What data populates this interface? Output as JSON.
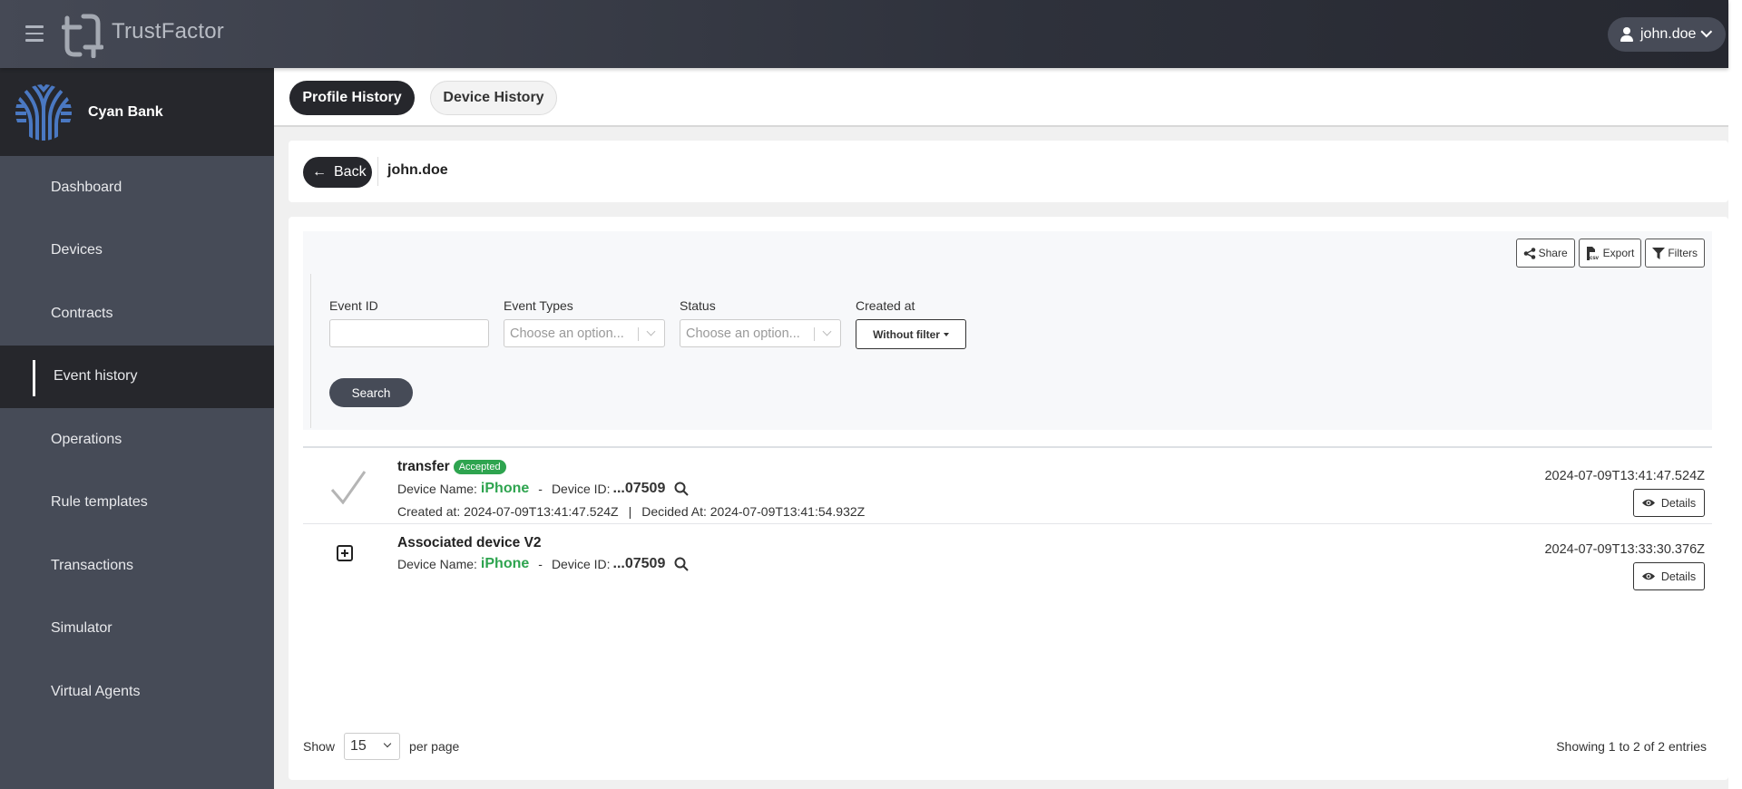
{
  "app": {
    "brand": "TrustFactor",
    "user": "john.doe"
  },
  "organization": {
    "name": "Cyan Bank",
    "logo_color": "#4a78c2"
  },
  "sidebar": {
    "items": [
      {
        "label": "Dashboard"
      },
      {
        "label": "Devices"
      },
      {
        "label": "Contracts"
      },
      {
        "label": "Event history",
        "active": true
      },
      {
        "label": "Operations"
      },
      {
        "label": "Rule templates"
      },
      {
        "label": "Transactions"
      },
      {
        "label": "Simulator"
      },
      {
        "label": "Virtual Agents"
      }
    ]
  },
  "tabs": [
    {
      "label": "Profile History",
      "active": true
    },
    {
      "label": "Device History",
      "active": false
    }
  ],
  "breadcrumb": {
    "back_label": "Back",
    "current": "john.doe"
  },
  "toolbar": {
    "share": "Share",
    "export": "Export",
    "filters": "Filters"
  },
  "filters": {
    "event_id": {
      "label": "Event ID",
      "value": ""
    },
    "event_types": {
      "label": "Event Types",
      "placeholder": "Choose an option..."
    },
    "status": {
      "label": "Status",
      "placeholder": "Choose an option..."
    },
    "created_at": {
      "label": "Created at",
      "value": "Without filter"
    },
    "search_label": "Search"
  },
  "events": [
    {
      "icon": "check-icon",
      "title": "transfer",
      "status": "Accepted",
      "status_color": "#2ea44f",
      "device_name_label": "Device Name:",
      "device_name": "iPhone",
      "device_id_label": "Device ID:",
      "device_id": "...07509",
      "created_label": "Created at: 2024-07-09T13:41:47.524Z",
      "decided_label": "Decided At: 2024-07-09T13:41:54.932Z",
      "timestamp": "2024-07-09T13:41:47.524Z",
      "details_label": "Details"
    },
    {
      "icon": "plus-square-icon",
      "title": "Associated device V2",
      "device_name_label": "Device Name:",
      "device_name": "iPhone",
      "device_id_label": "Device ID:",
      "device_id": "...07509",
      "timestamp": "2024-07-09T13:33:30.376Z",
      "details_label": "Details"
    }
  ],
  "pagination": {
    "show_label": "Show",
    "per_page_value": "15",
    "per_page_label": "per page",
    "summary": "Showing 1 to 2 of 2 entries"
  }
}
